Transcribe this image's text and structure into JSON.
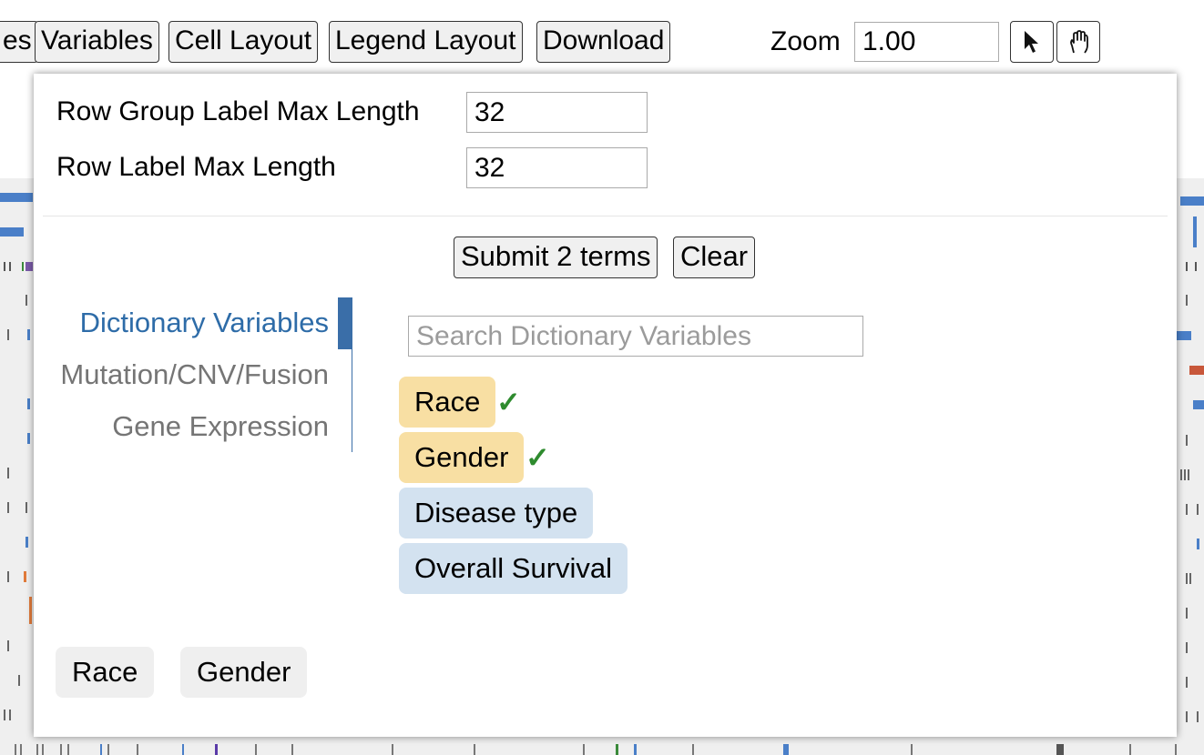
{
  "toolbar": {
    "tab_partial": "es",
    "variables": "Variables",
    "cell_layout": "Cell Layout",
    "legend_layout": "Legend Layout",
    "download": "Download",
    "zoom_label": "Zoom",
    "zoom_value": "1.00",
    "select_mode_icon": "arrow-cursor-icon",
    "pan_mode_icon": "grab-hand-icon"
  },
  "settings": {
    "row_group_label_max_length": {
      "label": "Row Group Label Max Length",
      "value": "32"
    },
    "row_label_max_length": {
      "label": "Row Label Max Length",
      "value": "32"
    }
  },
  "actions": {
    "submit": "Submit 2 terms",
    "clear": "Clear"
  },
  "tabs": [
    {
      "label": "Dictionary Variables",
      "active": true
    },
    {
      "label": "Mutation/CNV/Fusion",
      "active": false
    },
    {
      "label": "Gene Expression",
      "active": false
    }
  ],
  "search": {
    "placeholder": "Search Dictionary Variables"
  },
  "terms": [
    {
      "label": "Race",
      "selected": true
    },
    {
      "label": "Gender",
      "selected": true
    },
    {
      "label": "Disease type",
      "selected": false
    },
    {
      "label": "Overall Survival",
      "selected": false
    }
  ],
  "check_mark": "✓",
  "selected_pills": [
    "Race",
    "Gender"
  ],
  "colors": {
    "selected_term": "#f8dfa3",
    "unselected_term": "#d3e2f0",
    "active_tab": "#2e6ca8",
    "inactive_tab": "#757575",
    "check": "#2e8b2e"
  }
}
